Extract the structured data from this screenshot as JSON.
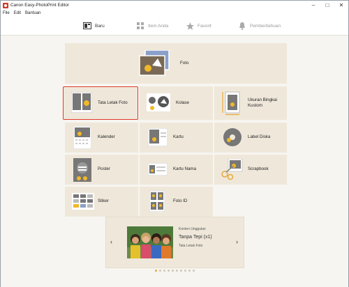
{
  "window": {
    "title": "Canon Easy-PhotoPrint Editor"
  },
  "menu": [
    "File",
    "Edit",
    "Bantuan"
  ],
  "tabs": [
    {
      "label": "Baru",
      "icon": "new-icon",
      "active": true
    },
    {
      "label": "Item Anda",
      "icon": "item-grid-icon",
      "active": false
    },
    {
      "label": "Favorit",
      "icon": "star-icon",
      "active": false
    },
    {
      "label": "Pemberitahuan",
      "icon": "bell-icon",
      "active": false
    }
  ],
  "tiles": {
    "foto": "Foto",
    "tata_letak_foto": "Tata Letak Foto",
    "kolase": "Kolase",
    "ukuran_bingkai_kustom": "Ukuran Bingkai Kustom",
    "kalender": "Kalender",
    "kartu": "Kartu",
    "label_diska": "Label Diska",
    "poster": "Poster",
    "kartu_nama": "Kartu Nama",
    "scrapbook": "Scrapbook",
    "stiker": "Stiker",
    "foto_id": "Foto ID"
  },
  "carousel": {
    "heading": "Konten Unggulan",
    "title": "Tanpa Tepi (x1)",
    "subtitle": "Tata Letak Foto",
    "slide_count": 10,
    "active_slide": 1
  },
  "colors": {
    "accent": "#e6a93a",
    "selection": "#e23a2a",
    "tile_bg": "#efe8da"
  }
}
